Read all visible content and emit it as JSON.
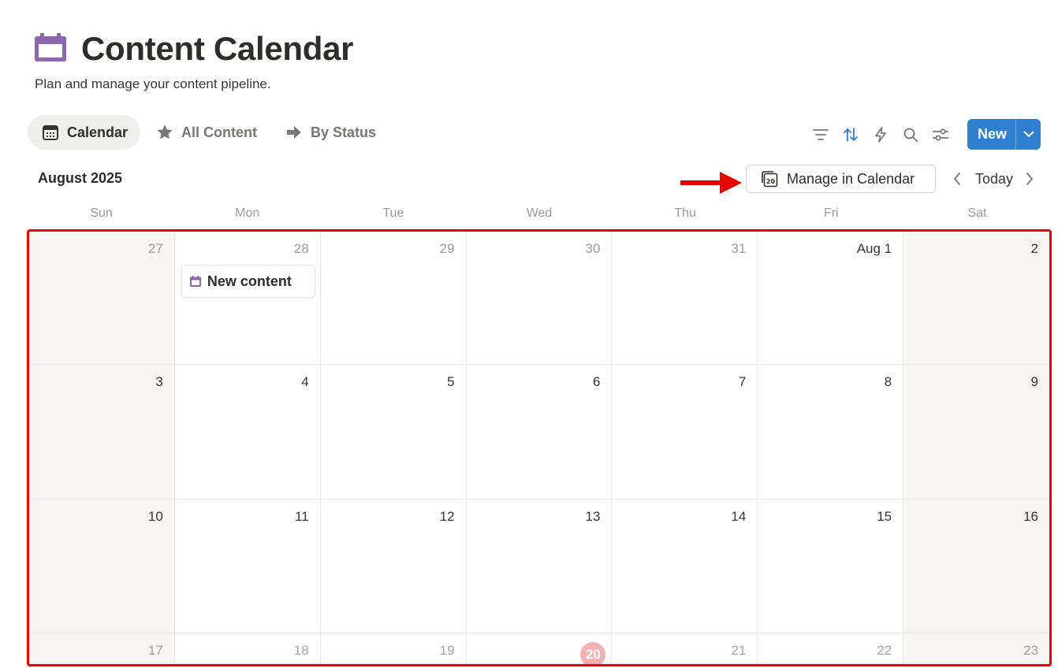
{
  "page": {
    "title": "Content Calendar",
    "description": "Plan and manage your content pipeline.",
    "icon": "calendar-icon",
    "icon_color": "#9065b0"
  },
  "tabs": [
    {
      "label": "Calendar",
      "icon": "calendar-icon",
      "active": true
    },
    {
      "label": "All Content",
      "icon": "star-icon",
      "active": false
    },
    {
      "label": "By Status",
      "icon": "arrow-right-icon",
      "active": false
    }
  ],
  "toolbar": {
    "icons": [
      "filter-icon",
      "sort-icon",
      "lightning-icon",
      "search-icon",
      "settings-sliders-icon"
    ],
    "new_label": "New",
    "new_color": "#2f80d0",
    "sort_color": "#2f80d0"
  },
  "calendar": {
    "month_label": "August 2025",
    "manage_label": "Manage in Calendar",
    "today_label": "Today",
    "weekdays": [
      "Sun",
      "Mon",
      "Tue",
      "Wed",
      "Thu",
      "Fri",
      "Sat"
    ],
    "today_color": "#eb5757",
    "weeks": [
      [
        {
          "label": "27",
          "muted": true
        },
        {
          "label": "28",
          "muted": true,
          "event": "New content"
        },
        {
          "label": "29",
          "muted": true
        },
        {
          "label": "30",
          "muted": true
        },
        {
          "label": "31",
          "muted": true
        },
        {
          "label": "Aug 1",
          "muted": false
        },
        {
          "label": "2",
          "muted": false
        }
      ],
      [
        {
          "label": "3"
        },
        {
          "label": "4"
        },
        {
          "label": "5"
        },
        {
          "label": "6"
        },
        {
          "label": "7"
        },
        {
          "label": "8"
        },
        {
          "label": "9"
        }
      ],
      [
        {
          "label": "10"
        },
        {
          "label": "11"
        },
        {
          "label": "12"
        },
        {
          "label": "13"
        },
        {
          "label": "14"
        },
        {
          "label": "15"
        },
        {
          "label": "16"
        }
      ],
      [
        {
          "label": "17"
        },
        {
          "label": "18"
        },
        {
          "label": "19"
        },
        {
          "label": "20",
          "today": true
        },
        {
          "label": "21"
        },
        {
          "label": "22"
        },
        {
          "label": "23"
        }
      ]
    ]
  },
  "annotations": {
    "highlight_color": "#e60000"
  }
}
